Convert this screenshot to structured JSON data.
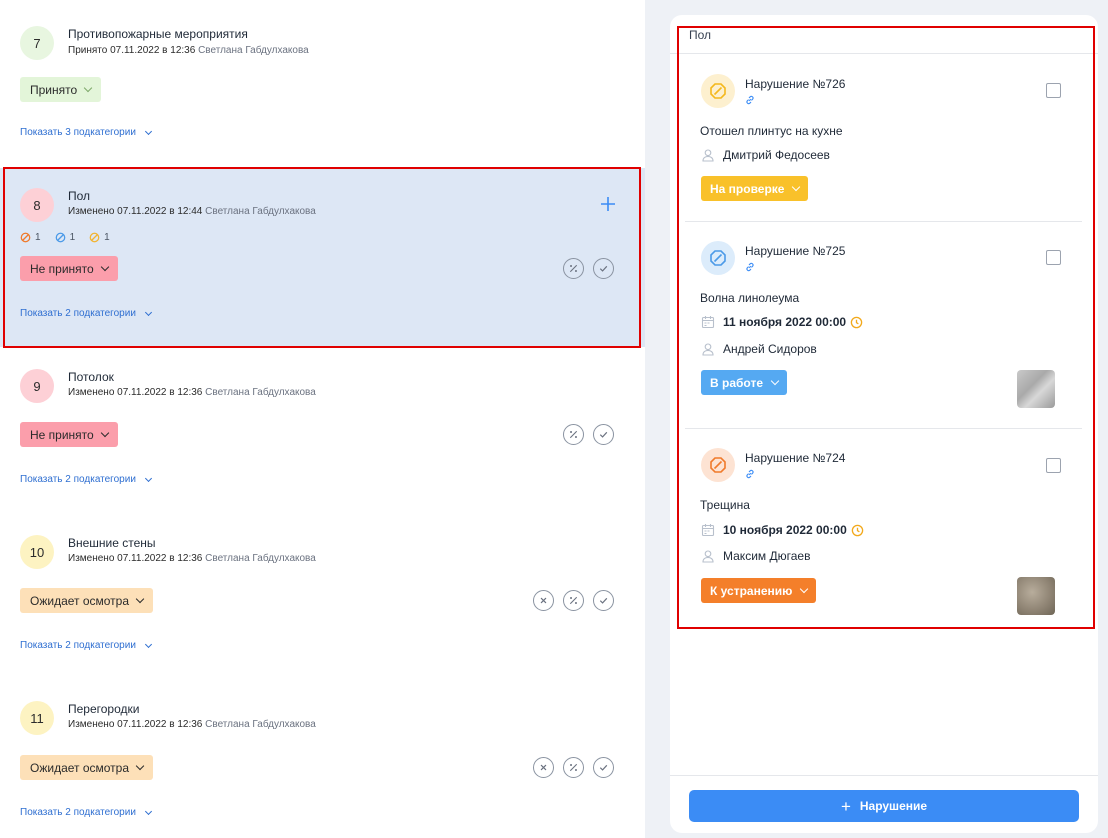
{
  "categories": [
    {
      "number": "7",
      "title": "Противопожарные мероприятия",
      "meta": "Принято  07.11.2022 в 12:36",
      "user": "Светлана Габдулхакова",
      "status": "Принято",
      "show": "Показать 3 подкатегории"
    },
    {
      "number": "8",
      "title": "Пол",
      "meta": "Изменено  07.11.2022 в 12:44",
      "user": "Светлана Габдулхакова",
      "status": "Не принято",
      "show": "Показать 2 подкатегории",
      "counts": [
        "1",
        "1",
        "1"
      ]
    },
    {
      "number": "9",
      "title": "Потолок",
      "meta": "Изменено  07.11.2022 в 12:36",
      "user": "Светлана Габдулхакова",
      "status": "Не принято",
      "show": "Показать 2 подкатегории"
    },
    {
      "number": "10",
      "title": "Внешние стены",
      "meta": "Изменено  07.11.2022 в 12:36",
      "user": "Светлана Габдулхакова",
      "status": "Ожидает осмотра",
      "show": "Показать 2 подкатегории"
    },
    {
      "number": "11",
      "title": "Перегородки",
      "meta": "Изменено  07.11.2022 в 12:36",
      "user": "Светлана Габдулхакова",
      "status": "Ожидает осмотра",
      "show": "Показать 2 подкатегории"
    }
  ],
  "panel": {
    "title": "Пол",
    "violations": [
      {
        "title": "Нарушение №726",
        "description": "Отошел плинтус на кухне",
        "person": "Дмитрий Федосеев",
        "status": "На проверке"
      },
      {
        "title": "Нарушение №725",
        "description": "Волна линолеума",
        "date": "11 ноября 2022 00:00",
        "person": "Андрей Сидоров",
        "status": "В работе"
      },
      {
        "title": "Нарушение №724",
        "description": "Трещина",
        "date": "10 ноября 2022 00:00",
        "person": "Максим Дюгаев",
        "status": "К устранению"
      }
    ],
    "add_button": "Нарушение"
  },
  "colors": {
    "accent": "#3b8cf5",
    "link": "#2f6fd1",
    "selected_bg": "#dde7f5",
    "highlight": "#e00000"
  },
  "icons": [
    "plus-icon",
    "percent-icon",
    "check-icon",
    "close-icon",
    "link-icon",
    "calendar-icon",
    "clock-icon",
    "user-icon",
    "no-entry-icon"
  ]
}
